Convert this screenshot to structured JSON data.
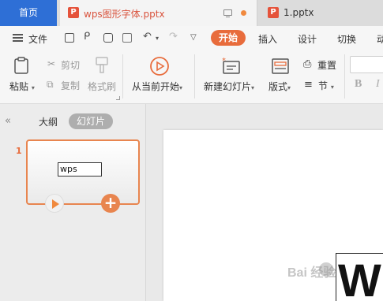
{
  "tabs": {
    "home": "首页",
    "doc1": "wps图形字体.pptx",
    "doc2": "1.pptx"
  },
  "menubar": {
    "file": "文件",
    "ribbon_tabs": [
      "开始",
      "插入",
      "设计",
      "切换",
      "动"
    ]
  },
  "ribbon": {
    "paste": "粘贴",
    "cut": "剪切",
    "copy": "复制",
    "format_painter": "格式刷",
    "start_from_current": "从当前开始",
    "new_slide": "新建幻灯片",
    "layout": "版式",
    "reset": "重置",
    "section": "节",
    "bold": "B",
    "italic": "I"
  },
  "sidebar": {
    "outline": "大纲",
    "slides": "幻灯片",
    "slide_number": "1",
    "thumb_text": "wps"
  },
  "canvas": {
    "big_text": "W"
  },
  "watermark": "Bai  经验",
  "colors": {
    "accent": "#e86c3c",
    "home_tab": "#2e6fd6",
    "ppt_icon": "#e5533b"
  }
}
